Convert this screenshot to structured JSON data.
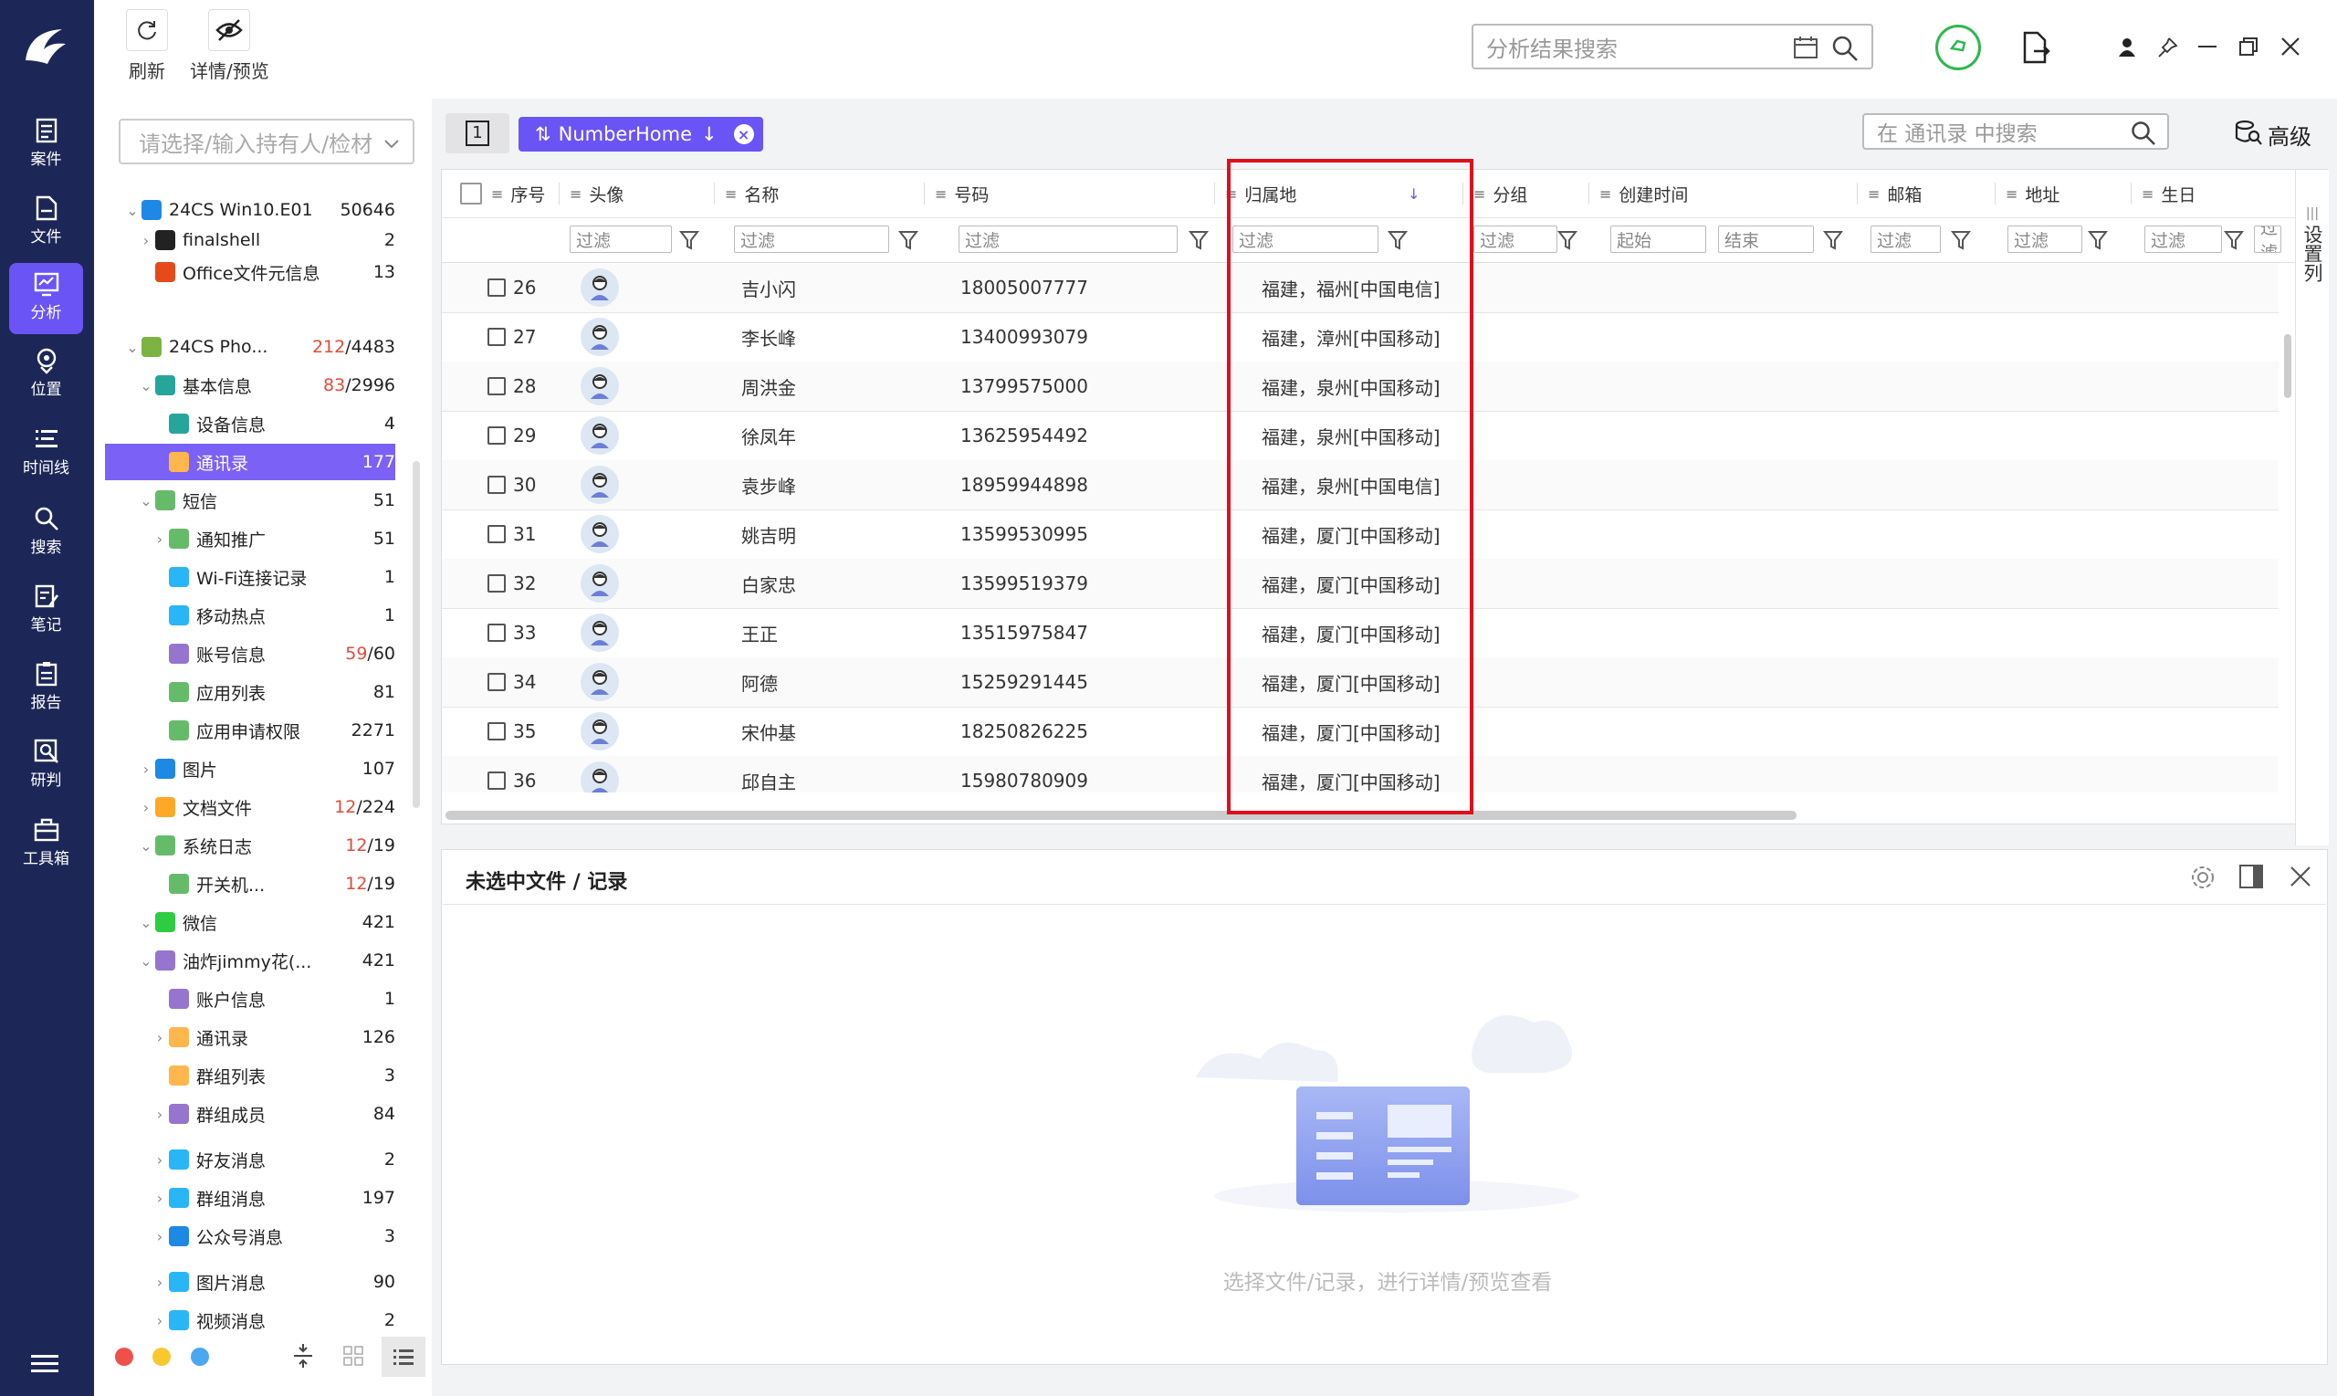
{
  "toolbar": {
    "refresh_label": "刷新",
    "details_label": "详情/预览",
    "search_placeholder": "分析结果搜索"
  },
  "nav": {
    "items": [
      {
        "label": "案件",
        "icon": "case-icon"
      },
      {
        "label": "文件",
        "icon": "file-icon"
      },
      {
        "label": "分析",
        "icon": "analysis-icon"
      },
      {
        "label": "位置",
        "icon": "location-icon"
      },
      {
        "label": "时间线",
        "icon": "timeline-icon"
      },
      {
        "label": "搜索",
        "icon": "search-icon"
      },
      {
        "label": "笔记",
        "icon": "notes-icon"
      },
      {
        "label": "报告",
        "icon": "report-icon"
      },
      {
        "label": "研判",
        "icon": "judge-icon"
      },
      {
        "label": "工具箱",
        "icon": "toolbox-icon"
      }
    ]
  },
  "tree": {
    "select_placeholder": "请选择/输入持有人/检材",
    "rows": [
      {
        "label": "24CS Win10.E01",
        "count": "50646",
        "red": "",
        "icon_color": "#1e88e5"
      },
      {
        "label": "finalshell",
        "count": "2",
        "red": "",
        "icon_color": "#222"
      },
      {
        "label": "Office文件元信息",
        "count": "13",
        "red": "",
        "icon_color": "#e64a19"
      },
      {
        "label": "24CS Pho...",
        "count": "/4483",
        "red": "212",
        "icon_color": "#7cb342"
      },
      {
        "label": "基本信息",
        "count": "/2996",
        "red": "83",
        "icon_color": "#26a69a"
      },
      {
        "label": "设备信息",
        "count": "4",
        "red": "",
        "icon_color": "#26a69a"
      },
      {
        "label": "通讯录",
        "count": "177",
        "red": "",
        "icon_color": "#ffb74d"
      },
      {
        "label": "短信",
        "count": "51",
        "red": "",
        "icon_color": "#66bb6a"
      },
      {
        "label": "通知推广",
        "count": "51",
        "red": "",
        "icon_color": "#66bb6a"
      },
      {
        "label": "Wi-Fi连接记录",
        "count": "1",
        "red": "",
        "icon_color": "#29b6f6"
      },
      {
        "label": "移动热点",
        "count": "1",
        "red": "",
        "icon_color": "#29b6f6"
      },
      {
        "label": "账号信息",
        "count": "/60",
        "red": "59",
        "icon_color": "#9575cd"
      },
      {
        "label": "应用列表",
        "count": "81",
        "red": "",
        "icon_color": "#66bb6a"
      },
      {
        "label": "应用申请权限",
        "count": "2271",
        "red": "",
        "icon_color": "#66bb6a"
      },
      {
        "label": "图片",
        "count": "107",
        "red": "",
        "icon_color": "#1e88e5"
      },
      {
        "label": "文档文件",
        "count": "/224",
        "red": "12",
        "icon_color": "#ffa726"
      },
      {
        "label": "系统日志",
        "count": "/19",
        "red": "12",
        "icon_color": "#66bb6a"
      },
      {
        "label": "开关机...",
        "count": "/19",
        "red": "12",
        "icon_color": "#66bb6a"
      },
      {
        "label": "微信",
        "count": "421",
        "red": "",
        "icon_color": "#2ecc40"
      },
      {
        "label": "油炸jimmy花(...",
        "count": "421",
        "red": "",
        "icon_color": "#9575cd"
      },
      {
        "label": "账户信息",
        "count": "1",
        "red": "",
        "icon_color": "#9575cd"
      },
      {
        "label": "通讯录",
        "count": "126",
        "red": "",
        "icon_color": "#ffb74d"
      },
      {
        "label": "群组列表",
        "count": "3",
        "red": "",
        "icon_color": "#ffb74d"
      },
      {
        "label": "群组成员",
        "count": "84",
        "red": "",
        "icon_color": "#9575cd"
      },
      {
        "label": "好友消息",
        "count": "2",
        "red": "",
        "icon_color": "#29b6f6"
      },
      {
        "label": "群组消息",
        "count": "197",
        "red": "",
        "icon_color": "#29b6f6"
      },
      {
        "label": "公众号消息",
        "count": "3",
        "red": "",
        "icon_color": "#1e88e5"
      },
      {
        "label": "图片消息",
        "count": "90",
        "red": "",
        "icon_color": "#29b6f6"
      },
      {
        "label": "视频消息",
        "count": "2",
        "red": "",
        "icon_color": "#29b6f6"
      }
    ]
  },
  "table": {
    "page_indicator": "1",
    "sort_tag": "NumberHome",
    "search_placeholder": "在 通讯录 中搜索",
    "advanced_label": "高级",
    "settings_column_label": "设置列",
    "columns": [
      "序号",
      "头像",
      "名称",
      "号码",
      "归属地",
      "分组",
      "创建时间",
      "邮箱",
      "地址",
      "生日"
    ],
    "filter_placeholder": "过滤",
    "filter_start": "起始",
    "filter_end": "结束",
    "rows": [
      {
        "no": "26",
        "name": "吉小闪",
        "phone": "18005007777",
        "location": "福建，福州[中国电信]"
      },
      {
        "no": "27",
        "name": "李长峰",
        "phone": "13400993079",
        "location": "福建，漳州[中国移动]"
      },
      {
        "no": "28",
        "name": "周洪金",
        "phone": "13799575000",
        "location": "福建，泉州[中国移动]"
      },
      {
        "no": "29",
        "name": "徐凤年",
        "phone": "13625954492",
        "location": "福建，泉州[中国移动]"
      },
      {
        "no": "30",
        "name": "袁步峰",
        "phone": "18959944898",
        "location": "福建，泉州[中国电信]"
      },
      {
        "no": "31",
        "name": "姚吉明",
        "phone": "13599530995",
        "location": "福建，厦门[中国移动]"
      },
      {
        "no": "32",
        "name": "白家忠",
        "phone": "13599519379",
        "location": "福建，厦门[中国移动]"
      },
      {
        "no": "33",
        "name": "王正",
        "phone": "13515975847",
        "location": "福建，厦门[中国移动]"
      },
      {
        "no": "34",
        "name": "阿德",
        "phone": "15259291445",
        "location": "福建，厦门[中国移动]"
      },
      {
        "no": "35",
        "name": "宋仲基",
        "phone": "18250826225",
        "location": "福建，厦门[中国移动]"
      },
      {
        "no": "36",
        "name": "邱自主",
        "phone": "15980780909",
        "location": "福建，厦门[中国移动]"
      }
    ]
  },
  "preview": {
    "title": "未选中文件 / 记录",
    "empty_text": "选择文件/记录，进行详情/预览查看"
  },
  "colors": {
    "nav_bg": "#1d2757",
    "accent": "#6b54f5",
    "highlight_box": "#e0101a",
    "status_green": "#2db84d"
  }
}
